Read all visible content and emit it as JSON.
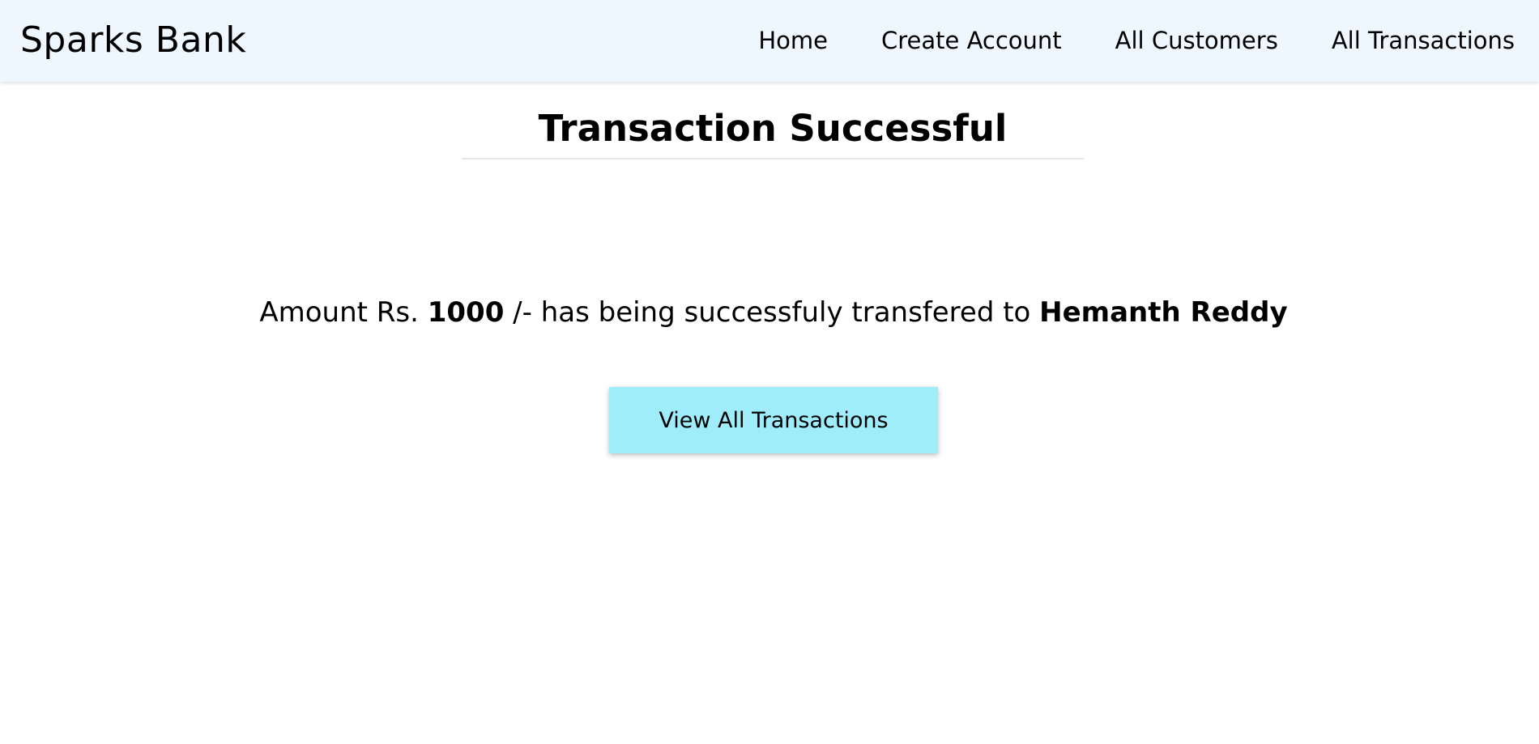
{
  "header": {
    "brand": "Sparks Bank",
    "nav": [
      {
        "label": "Home"
      },
      {
        "label": "Create Account"
      },
      {
        "label": "All Customers"
      },
      {
        "label": "All Transactions"
      }
    ]
  },
  "main": {
    "title": "Transaction Successful",
    "message": {
      "prefix": "Amount Rs.",
      "amount": "1000",
      "middle": "/- has being successfuly transfered to",
      "recipient": "Hemanth Reddy"
    },
    "button_label": "View All Transactions"
  },
  "colors": {
    "navbar_bg": "#eef6fe",
    "button_bg": "#9fecfb",
    "rule": "#e6e6e6"
  }
}
